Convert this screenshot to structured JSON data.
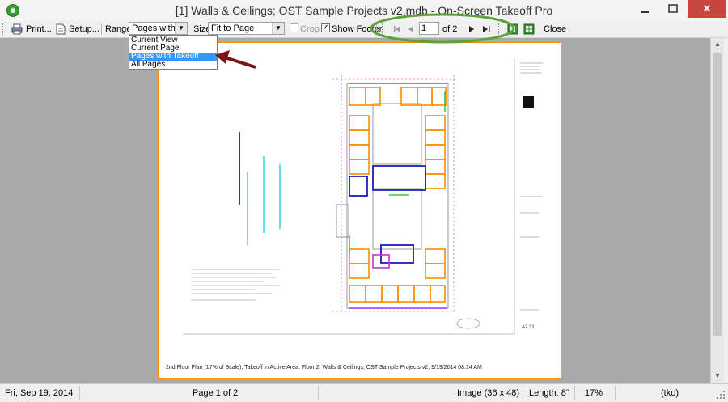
{
  "window": {
    "title": "[1] Walls & Ceilings; OST Sample Projects v2.mdb - On-Screen Takeoff Pro",
    "close": "✕"
  },
  "toolbar": {
    "print": "Print...",
    "setup": "Setup...",
    "range_label": "Range",
    "range_value": "Pages with Ta",
    "size_label": "Size",
    "size_value": "Fit to Page",
    "crop_label": "Crop",
    "show_footer_label": "Show Footer",
    "page_value": "1",
    "page_of": "of 2",
    "close_label": "Close"
  },
  "range_options": [
    "Current View",
    "Current Page",
    "Pages with Takeoff",
    "All Pages"
  ],
  "range_selected_index": 2,
  "footer_text": "2nd Floor Plan (17% of Scale); Takeoff in Active Area: Floor 2; Walls & Ceilings; OST Sample Projects v2; 9/19/2014 08:14 AM",
  "sheet": {
    "number": "A2.31"
  },
  "status": {
    "date": "Fri, Sep 19, 2014",
    "page": "Page 1 of 2",
    "image": "Image (36 x 48)",
    "length": "Length: 8\"",
    "zoom": "17%",
    "mode": "(tko)"
  },
  "colors": {
    "highlight_ring": "#5ba43a",
    "arrow": "#7a1515",
    "page_border": "#ff8c00",
    "selection": "#3399ff",
    "takeoff_orange": "#ff8c00",
    "takeoff_blue": "#1c1cbf",
    "takeoff_magenta": "#cc33cc",
    "takeoff_green": "#33cc33",
    "takeoff_cyan": "#33e0e6"
  }
}
